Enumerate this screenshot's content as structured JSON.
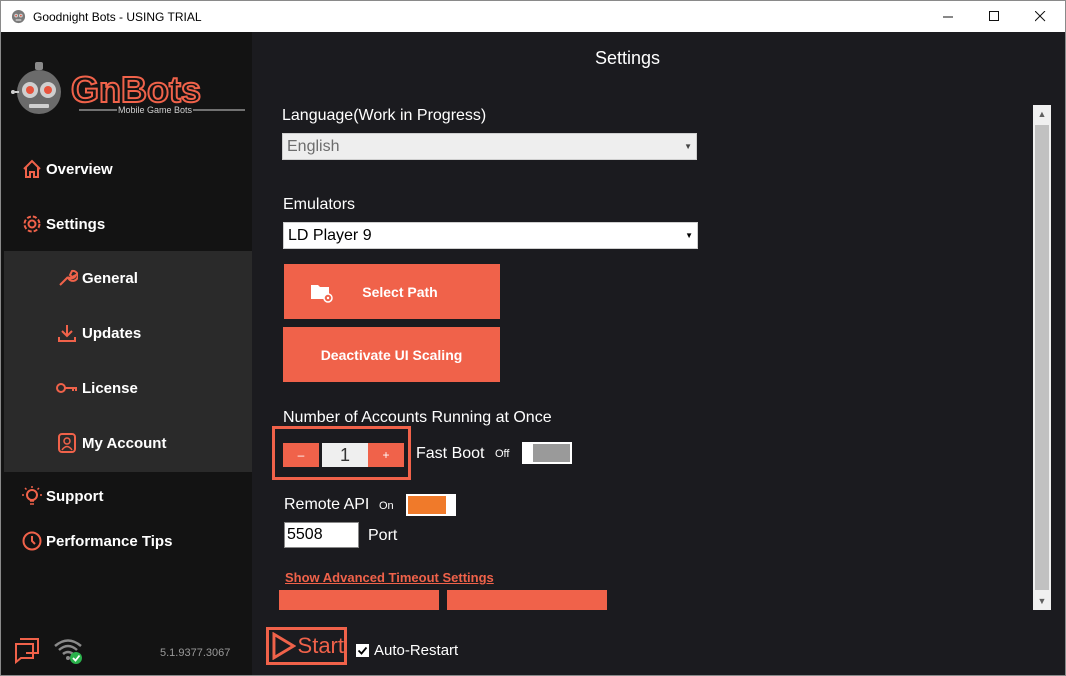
{
  "window": {
    "title": "Goodnight Bots  - USING TRIAL"
  },
  "sidebar": {
    "logo_text": "GnBots",
    "logo_tagline": "Mobile Game Bots",
    "items": [
      {
        "label": "Overview",
        "icon": "home-icon"
      },
      {
        "label": "Settings",
        "icon": "gear-icon"
      },
      {
        "label": "Support",
        "icon": "lightbulb-icon"
      },
      {
        "label": "Performance Tips",
        "icon": "clock-icon"
      }
    ],
    "sub_items": [
      {
        "label": "General",
        "icon": "wrench-icon"
      },
      {
        "label": "Updates",
        "icon": "download-icon"
      },
      {
        "label": "License",
        "icon": "key-icon"
      },
      {
        "label": "My Account",
        "icon": "account-icon"
      }
    ],
    "version": "5.1.9377.3067"
  },
  "main": {
    "title": "Settings",
    "language_label": "Language(Work in Progress)",
    "language_value": "English",
    "emulators_label": "Emulators",
    "emulator_value": "LD Player 9",
    "select_path_label": "Select Path",
    "deactivate_label": "Deactivate UI Scaling",
    "accounts_label": "Number of Accounts Running at Once",
    "accounts_value": "1",
    "minus_label": "–",
    "plus_label": "+",
    "fast_boot_label": "Fast Boot",
    "fast_boot_state": "Off",
    "remote_api_label": "Remote API",
    "remote_api_state": "On",
    "port_value": "5508",
    "port_label": "Port",
    "advanced_link": "Show Advanced Timeout Settings",
    "start_label": "Start",
    "auto_restart_label": "Auto-Restart",
    "auto_restart_checked": true
  },
  "colors": {
    "accent": "#f0624a",
    "toggle_on": "#f07a2a",
    "toggle_off": "#9a9a9a",
    "sidebar_bg": "#131313",
    "main_bg": "#1b1b1f"
  }
}
